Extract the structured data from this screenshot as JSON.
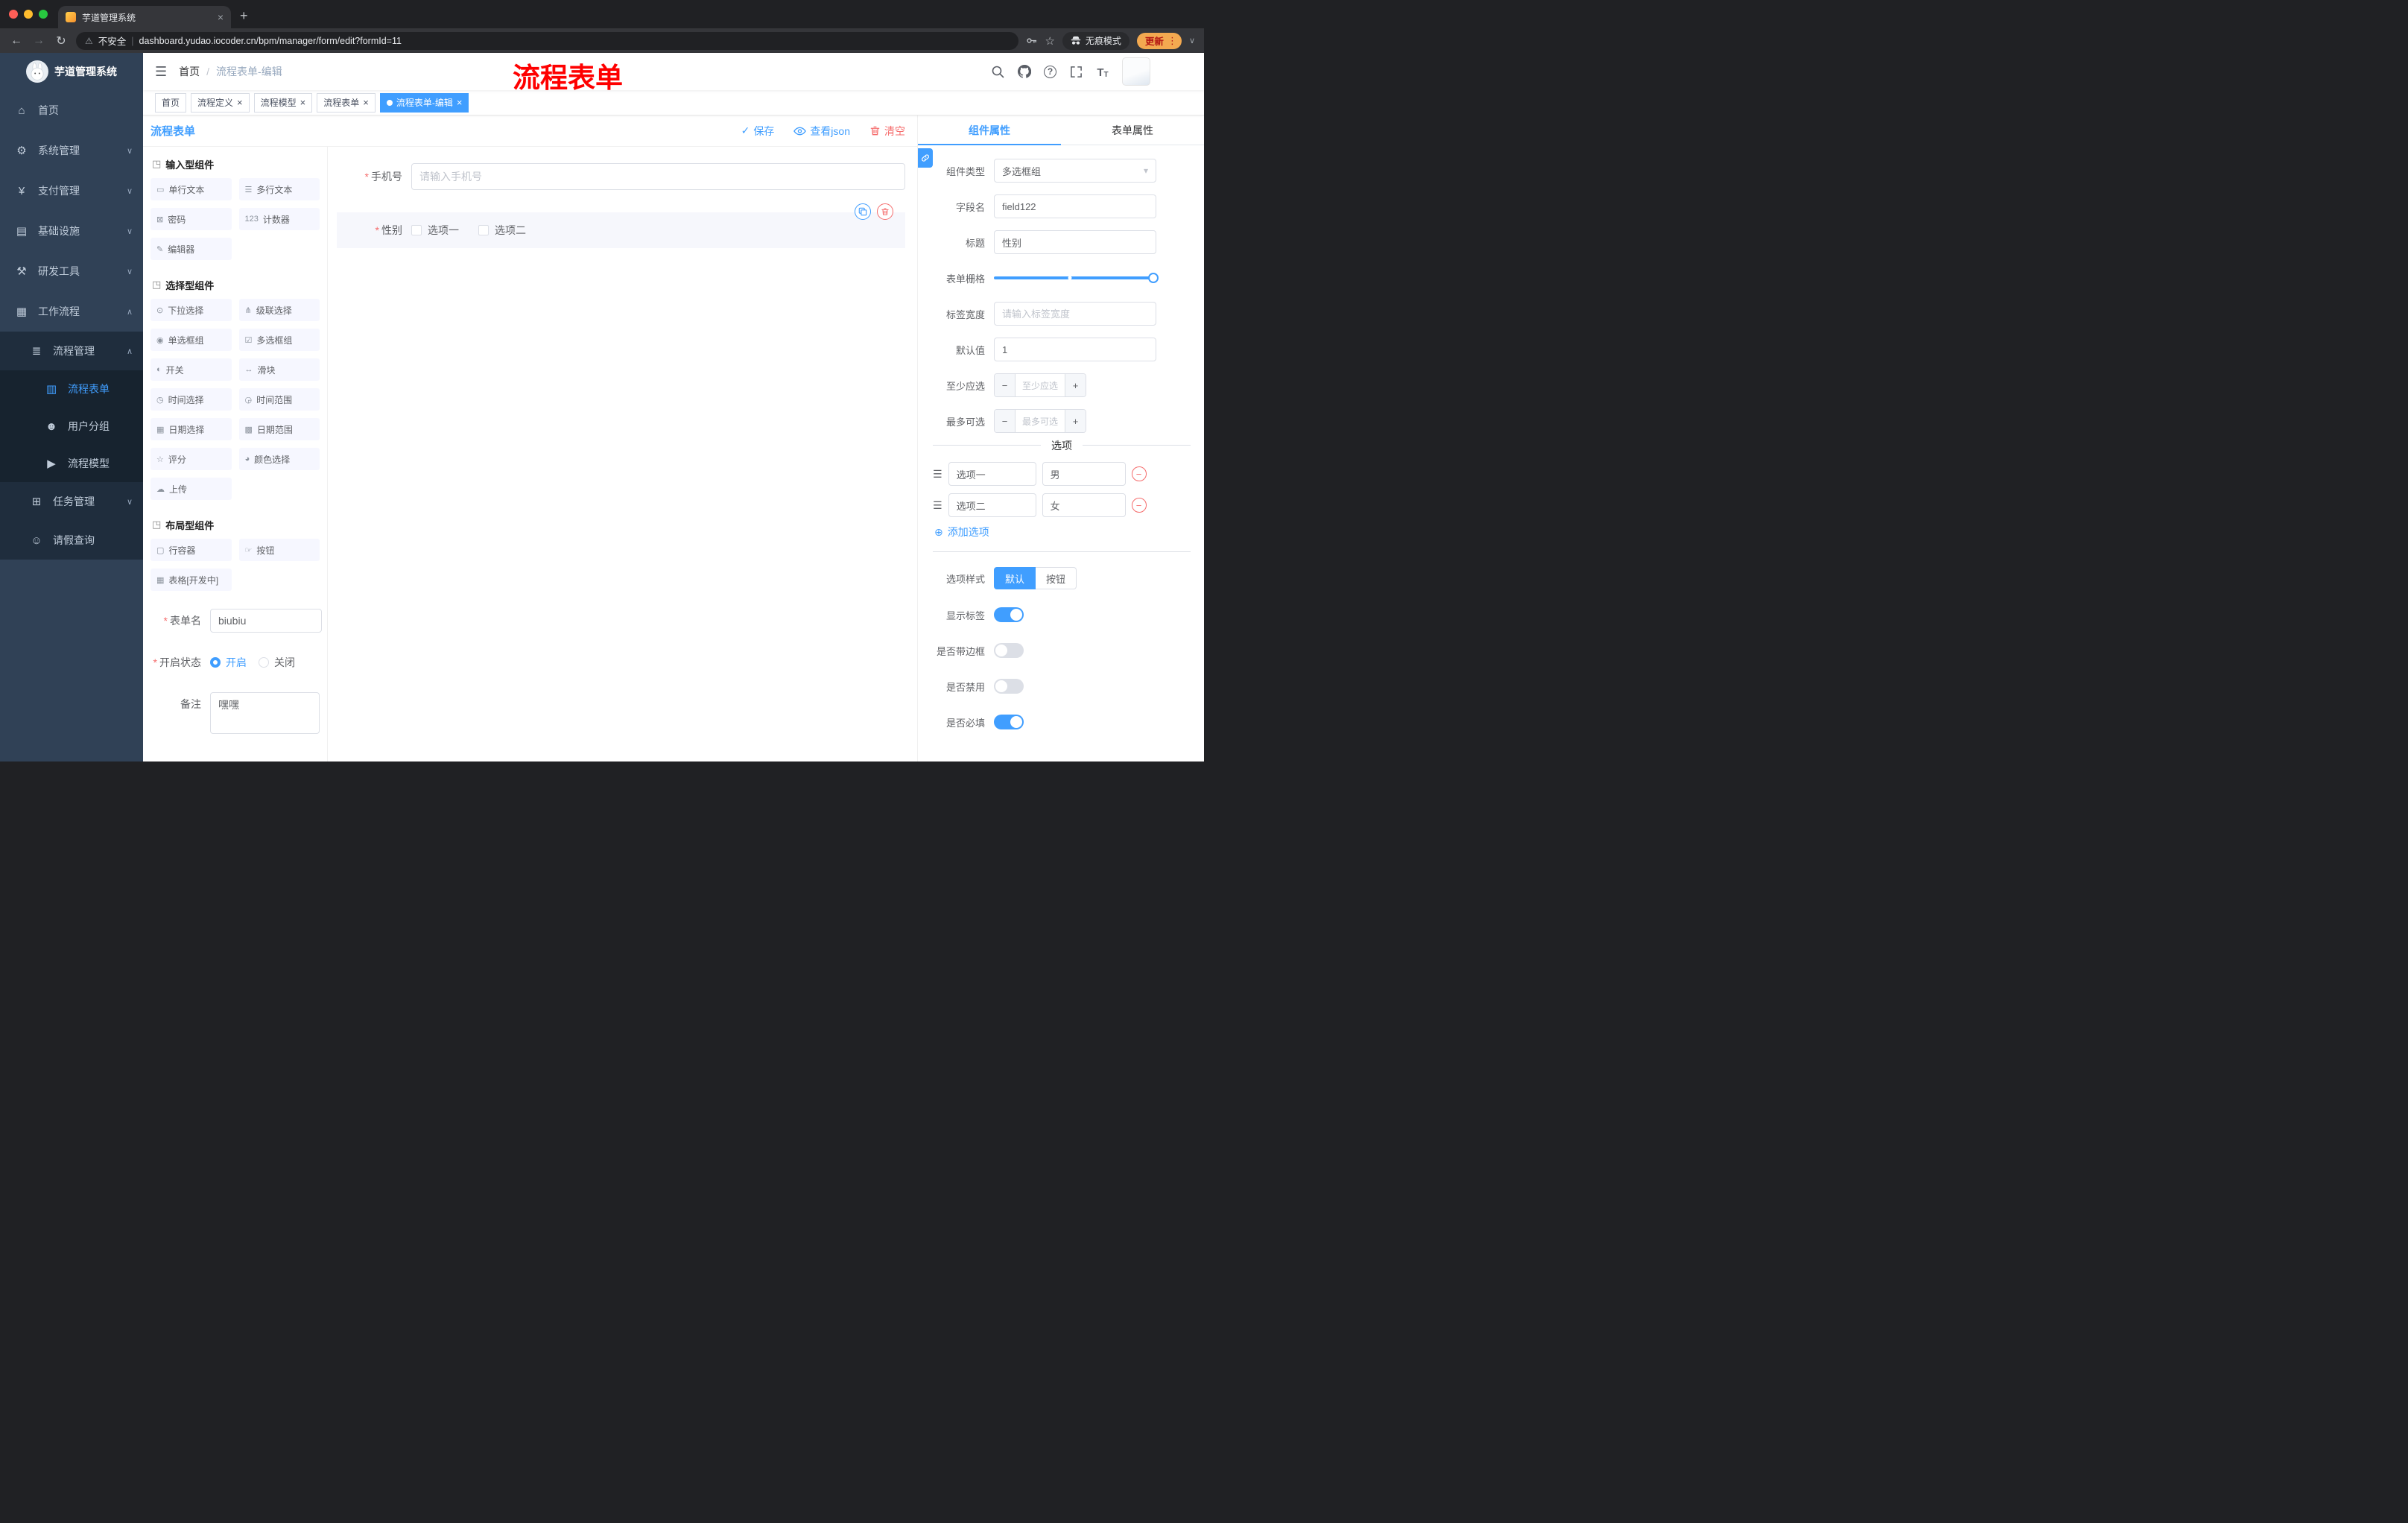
{
  "browser": {
    "tab_title": "芋道管理系统",
    "security_label": "不安全",
    "url": "dashboard.yudao.iocoder.cn/bpm/manager/form/edit?formId=11",
    "incognito_label": "无痕模式",
    "update_label": "更新"
  },
  "annotation": {
    "text": "流程表单"
  },
  "glyphs": {
    "hamburger": "☰",
    "back": "←",
    "forward": "→",
    "reload": "↻",
    "warning": "⚠",
    "divider": "|",
    "star": "☆",
    "dots": "⋮",
    "plus": "+",
    "close": "×",
    "chevron_down": "∨",
    "chevron_up": "∧",
    "breadcrumb_sep": "/",
    "select_arrow": "▾",
    "check": "✓",
    "minus": "−",
    "add_circle": "⊕",
    "section_cube": "◳",
    "drag": "☰",
    "question": "?",
    "font_size": "T",
    "asterisk": "*",
    "white_dot": ""
  },
  "sidebar": {
    "title": "芋道管理系统",
    "menu": [
      {
        "label": "首页",
        "icon": "⌂"
      },
      {
        "label": "系统管理",
        "icon": "⚙"
      },
      {
        "label": "支付管理",
        "icon": "¥"
      },
      {
        "label": "基础设施",
        "icon": "▤"
      },
      {
        "label": "研发工具",
        "icon": "⚒"
      },
      {
        "label": "工作流程",
        "icon": "▦"
      },
      {
        "label": "流程管理",
        "icon": "≣"
      },
      {
        "label": "流程表单",
        "icon": "▥"
      },
      {
        "label": "用户分组",
        "icon": "☻"
      },
      {
        "label": "流程模型",
        "icon": "▶"
      },
      {
        "label": "任务管理",
        "icon": "⊞"
      },
      {
        "label": "请假查询",
        "icon": "☺"
      }
    ]
  },
  "navbar": {
    "breadcrumb_home": "首页",
    "breadcrumb_current": "流程表单-编辑"
  },
  "tags": [
    {
      "label": "首页"
    },
    {
      "label": "流程定义"
    },
    {
      "label": "流程模型"
    },
    {
      "label": "流程表单"
    },
    {
      "label": "流程表单-编辑"
    }
  ],
  "builder": {
    "title": "流程表单",
    "save": "保存",
    "view_json": "查看json",
    "clear": "清空",
    "sections": [
      {
        "title": "输入型组件",
        "items": [
          {
            "label": "单行文本",
            "icon": "▭"
          },
          {
            "label": "多行文本",
            "icon": "☰"
          },
          {
            "label": "密码",
            "icon": "⊠"
          },
          {
            "label": "计数器",
            "icon": "123"
          },
          {
            "label": "编辑器",
            "icon": "✎"
          }
        ]
      },
      {
        "title": "选择型组件",
        "items": [
          {
            "label": "下拉选择",
            "icon": "⊙"
          },
          {
            "label": "级联选择",
            "icon": "⋔"
          },
          {
            "label": "单选框组",
            "icon": "◉"
          },
          {
            "label": "多选框组",
            "icon": "☑"
          },
          {
            "label": "开关",
            "icon": "◐"
          },
          {
            "label": "滑块",
            "icon": "↔"
          },
          {
            "label": "时间选择",
            "icon": "◷"
          },
          {
            "label": "时间范围",
            "icon": "◶"
          },
          {
            "label": "日期选择",
            "icon": "▦"
          },
          {
            "label": "日期范围",
            "icon": "▩"
          },
          {
            "label": "评分",
            "icon": "☆"
          },
          {
            "label": "颜色选择",
            "icon": "◕"
          },
          {
            "label": "上传",
            "icon": "☁"
          }
        ]
      },
      {
        "title": "布局型组件",
        "items": [
          {
            "label": "行容器",
            "icon": "▢"
          },
          {
            "label": "按钮",
            "icon": "☞"
          },
          {
            "label": "表格[开发中]",
            "icon": "▦"
          }
        ]
      }
    ],
    "config": {
      "form_name_label": "表单名",
      "form_name_value": "biubiu",
      "status_label": "开启状态",
      "status_on": "开启",
      "status_off": "关闭",
      "remark_label": "备注",
      "remark_value": "嘿嘿"
    },
    "canvas": {
      "phone_label": "手机号",
      "phone_placeholder": "请输入手机号",
      "gender_label": "性别",
      "gender_option1": "选项一",
      "gender_option2": "选项二"
    }
  },
  "props": {
    "tab_component": "组件属性",
    "tab_form": "表单属性",
    "component_type_label": "组件类型",
    "component_type_value": "多选框组",
    "field_name_label": "字段名",
    "field_name_value": "field122",
    "title_label": "标题",
    "title_value": "性别",
    "grid_label": "表单栅格",
    "label_width_label": "标签宽度",
    "label_width_placeholder": "请输入标签宽度",
    "default_label": "默认值",
    "default_value": "1",
    "min_label": "至少应选",
    "min_placeholder": "至少应选",
    "max_label": "最多可选",
    "max_placeholder": "最多可选",
    "options_title": "选项",
    "options": [
      {
        "name": "选项一",
        "value": "男"
      },
      {
        "name": "选项二",
        "value": "女"
      }
    ],
    "add_option": "添加选项",
    "style_label": "选项样式",
    "style_default": "默认",
    "style_button": "按钮",
    "show_label": "显示标签",
    "border_label": "是否带边框",
    "disabled_label": "是否禁用",
    "required_label": "是否必填"
  },
  "colors": {
    "accent": "#409eff",
    "danger": "#f56c6c",
    "sidebar_bg": "#304156"
  }
}
